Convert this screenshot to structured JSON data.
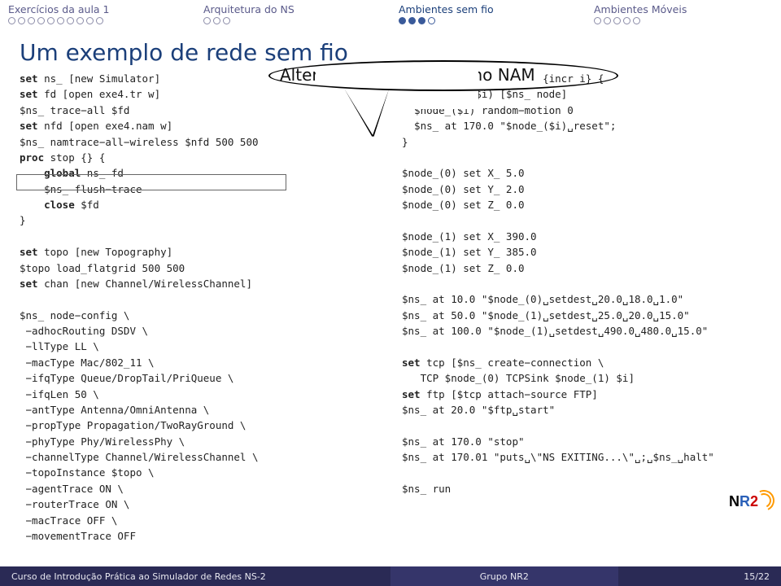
{
  "topnav": [
    {
      "label": "Exercícios da aula 1",
      "active": false,
      "dots": 10,
      "fill": 0
    },
    {
      "label": "Arquitetura do NS",
      "active": false,
      "dots": 3,
      "fill": 0
    },
    {
      "label": "Ambientes sem fio",
      "active": true,
      "dots": 4,
      "fill": 3
    },
    {
      "label": "Ambientes Móveis",
      "active": false,
      "dots": 5,
      "fill": 0
    }
  ],
  "title": "Um exemplo de rede sem fio",
  "callout": "Alteração para registro no NAM",
  "code": {
    "left": [
      {
        "kw": "set",
        "rest": " ns_ [new Simulator]"
      },
      {
        "kw": "set",
        "rest": " fd [open exe4.tr w]"
      },
      {
        "kw": "",
        "rest": "$ns_ trace−all $fd"
      },
      {
        "kw": "set",
        "rest": " nfd [open exe4.nam w]"
      },
      {
        "kw": "",
        "rest": "$ns_ namtrace−all−wireless $nfd 500 500"
      },
      {
        "kw": "proc",
        "rest": " stop {} {"
      },
      {
        "kw": "    global",
        "rest": " ns_ fd"
      },
      {
        "kw": "",
        "rest": "    $ns_ flush−trace"
      },
      {
        "kw": "    close",
        "rest": " $fd"
      },
      {
        "kw": "",
        "rest": "}"
      },
      {
        "kw": "",
        "rest": ""
      },
      {
        "kw": "set",
        "rest": " topo [new Topography]"
      },
      {
        "kw": "",
        "rest": "$topo load_flatgrid 500 500"
      },
      {
        "kw": "set",
        "rest": " chan [new Channel/WirelessChannel]"
      },
      {
        "kw": "",
        "rest": ""
      },
      {
        "kw": "",
        "rest": "$ns_ node−config \\"
      },
      {
        "kw": "",
        "rest": " −adhocRouting DSDV \\"
      },
      {
        "kw": "",
        "rest": " −llType LL \\"
      },
      {
        "kw": "",
        "rest": " −macType Mac/802_11 \\"
      },
      {
        "kw": "",
        "rest": " −ifqType Queue/DropTail/PriQueue \\"
      },
      {
        "kw": "",
        "rest": " −ifqLen 50 \\"
      },
      {
        "kw": "",
        "rest": " −antType Antenna/OmniAntenna \\"
      },
      {
        "kw": "",
        "rest": " −propType Propagation/TwoRayGround \\"
      },
      {
        "kw": "",
        "rest": " −phyType Phy/WirelessPhy \\"
      },
      {
        "kw": "",
        "rest": " −channelType Channel/WirelessChannel \\"
      },
      {
        "kw": "",
        "rest": " −topoInstance $topo \\"
      },
      {
        "kw": "",
        "rest": " −agentTrace ON \\"
      },
      {
        "kw": "",
        "rest": " −routerTrace ON \\"
      },
      {
        "kw": "",
        "rest": " −macTrace OFF \\"
      },
      {
        "kw": "",
        "rest": " −movementTrace OFF"
      }
    ],
    "right": [
      {
        "kw": "for",
        "rest": " {set i 0} {$i < 2} {incr i} {"
      },
      {
        "kw": "  set",
        "rest": " node_($i) [$ns_ node]"
      },
      {
        "kw": "",
        "rest": "  $node_($i) random−motion 0"
      },
      {
        "kw": "",
        "rest": "  $ns_ at 170.0 \"$node_($i)␣reset\";"
      },
      {
        "kw": "",
        "rest": "}"
      },
      {
        "kw": "",
        "rest": ""
      },
      {
        "kw": "",
        "rest": "$node_(0) set X_ 5.0"
      },
      {
        "kw": "",
        "rest": "$node_(0) set Y_ 2.0"
      },
      {
        "kw": "",
        "rest": "$node_(0) set Z_ 0.0"
      },
      {
        "kw": "",
        "rest": ""
      },
      {
        "kw": "",
        "rest": "$node_(1) set X_ 390.0"
      },
      {
        "kw": "",
        "rest": "$node_(1) set Y_ 385.0"
      },
      {
        "kw": "",
        "rest": "$node_(1) set Z_ 0.0"
      },
      {
        "kw": "",
        "rest": ""
      },
      {
        "kw": "",
        "rest": "$ns_ at 10.0 \"$node_(0)␣setdest␣20.0␣18.0␣1.0\""
      },
      {
        "kw": "",
        "rest": "$ns_ at 50.0 \"$node_(1)␣setdest␣25.0␣20.0␣15.0\""
      },
      {
        "kw": "",
        "rest": "$ns_ at 100.0 \"$node_(1)␣setdest␣490.0␣480.0␣15.0\""
      },
      {
        "kw": "",
        "rest": ""
      },
      {
        "kw": "set",
        "rest": " tcp [$ns_ create−connection \\"
      },
      {
        "kw": "",
        "rest": "   TCP $node_(0) TCPSink $node_(1) $i]"
      },
      {
        "kw": "set",
        "rest": " ftp [$tcp attach−source FTP]"
      },
      {
        "kw": "",
        "rest": "$ns_ at 20.0 \"$ftp␣start\""
      },
      {
        "kw": "",
        "rest": ""
      },
      {
        "kw": "",
        "rest": "$ns_ at 170.0 \"stop\""
      },
      {
        "kw": "",
        "rest": "$ns_ at 170.01 \"puts␣\\\"NS EXITING...\\\"␣;␣$ns_␣halt\""
      },
      {
        "kw": "",
        "rest": ""
      },
      {
        "kw": "",
        "rest": "$ns_ run"
      }
    ]
  },
  "footer": {
    "left": "Curso de Introdução Prática ao Simulador de Redes NS-2",
    "center": "Grupo NR2",
    "right": "15/22"
  },
  "logo": {
    "n": "N",
    "r": "R",
    "two": "2"
  }
}
